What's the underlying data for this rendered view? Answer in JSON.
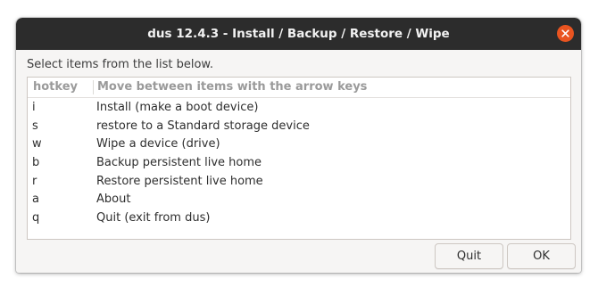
{
  "window": {
    "title": "dus 12.4.3 - Install / Backup / Restore / Wipe",
    "close_icon": "close-icon",
    "accent_color": "#e95420"
  },
  "prompt": "Select items from the list below.",
  "list": {
    "headers": {
      "hotkey": "hotkey",
      "description": "Move between items with the arrow keys"
    },
    "rows": [
      {
        "hotkey": "i",
        "description": "Install (make a boot device)"
      },
      {
        "hotkey": "s",
        "description": "restore to a Standard storage device"
      },
      {
        "hotkey": "w",
        "description": "Wipe a device (drive)"
      },
      {
        "hotkey": "b",
        "description": "Backup persistent live home"
      },
      {
        "hotkey": "r",
        "description": "Restore persistent live home"
      },
      {
        "hotkey": "a",
        "description": "About"
      },
      {
        "hotkey": "q",
        "description": "Quit (exit from dus)"
      }
    ]
  },
  "buttons": {
    "quit": "Quit",
    "ok": "OK"
  }
}
